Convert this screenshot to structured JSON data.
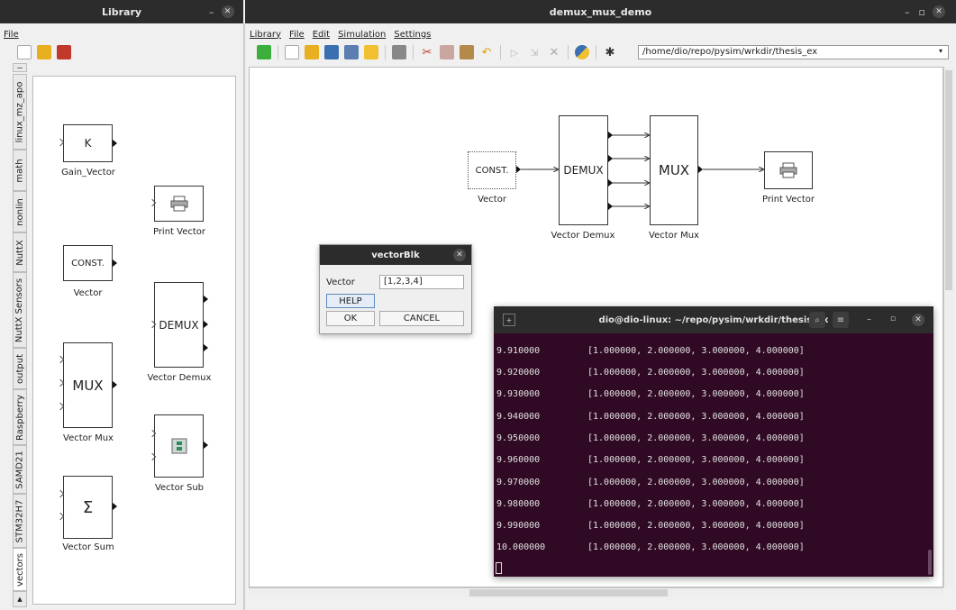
{
  "library_window": {
    "title": "Library",
    "menu": [
      "File"
    ],
    "tabs": [
      "linux_mz_apo",
      "math",
      "nonlin",
      "NuttX",
      "NuttX Sensors",
      "output",
      "Raspberry",
      "SAMD21",
      "STM32H7",
      "vectors"
    ],
    "blocks": {
      "gain_inner": "K",
      "gain_label": "Gain_Vector",
      "print_label": "Print Vector",
      "const_inner": "CONST.",
      "const_label": "Vector",
      "demux_inner": "DEMUX",
      "demux_label": "Vector Demux",
      "mux_inner": "MUX",
      "mux_label": "Vector Mux",
      "sub_label": "Vector Sub",
      "sum_inner": "Σ",
      "sum_label": "Vector Sum"
    }
  },
  "main_window": {
    "title": "demux_mux_demo",
    "menu": [
      "Library",
      "File",
      "Edit",
      "Simulation",
      "Settings"
    ],
    "path": "/home/dio/repo/pysim/wrkdir/thesis_ex",
    "diagram": {
      "const_inner": "CONST.",
      "const_label": "Vector",
      "demux_inner": "DEMUX",
      "demux_label": "Vector Demux",
      "mux_inner": "MUX",
      "mux_label": "Vector Mux",
      "print_label": "Print Vector"
    }
  },
  "dialog": {
    "title": "vectorBlk",
    "field_label": "Vector",
    "field_value": "[1,2,3,4]",
    "help": "HELP",
    "ok": "OK",
    "cancel": "CANCEL"
  },
  "terminal": {
    "title": "dio@dio-linux: ~/repo/pysim/wrkdir/thesis_ex",
    "lines": [
      {
        "t": "9.910000",
        "v": "[1.000000, 2.000000, 3.000000, 4.000000]"
      },
      {
        "t": "9.920000",
        "v": "[1.000000, 2.000000, 3.000000, 4.000000]"
      },
      {
        "t": "9.930000",
        "v": "[1.000000, 2.000000, 3.000000, 4.000000]"
      },
      {
        "t": "9.940000",
        "v": "[1.000000, 2.000000, 3.000000, 4.000000]"
      },
      {
        "t": "9.950000",
        "v": "[1.000000, 2.000000, 3.000000, 4.000000]"
      },
      {
        "t": "9.960000",
        "v": "[1.000000, 2.000000, 3.000000, 4.000000]"
      },
      {
        "t": "9.970000",
        "v": "[1.000000, 2.000000, 3.000000, 4.000000]"
      },
      {
        "t": "9.980000",
        "v": "[1.000000, 2.000000, 3.000000, 4.000000]"
      },
      {
        "t": "9.990000",
        "v": "[1.000000, 2.000000, 3.000000, 4.000000]"
      },
      {
        "t": "10.000000",
        "v": "[1.000000, 2.000000, 3.000000, 4.000000]"
      }
    ]
  },
  "colors": {
    "terminal_bg": "#300a24",
    "titlebar_bg": "#2c2c2c"
  }
}
